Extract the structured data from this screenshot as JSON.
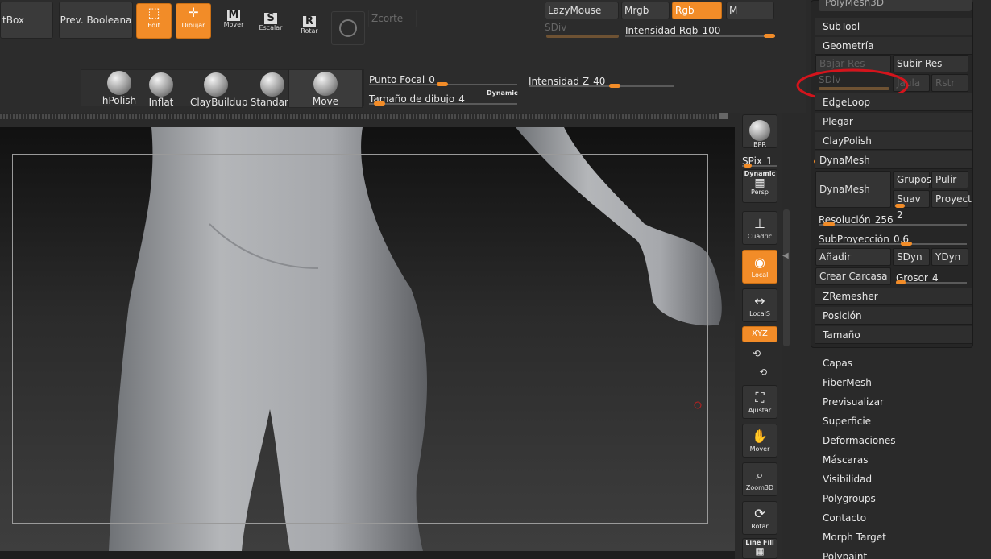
{
  "toolbar": {
    "lightbox_label": "tBox",
    "prev_booleana_label": "Prev. Booleana",
    "edit_label": "Edit",
    "dibujar_label": "Dibujar",
    "mover_label": "Mover",
    "escalar_label": "Escalar",
    "rotar_label": "Rotar",
    "zcorte_label": "Zcorte",
    "lazymouse_label": "LazyMouse",
    "mrgb_label": "Mrgb",
    "rgb_label": "Rgb",
    "m_label": "M",
    "sdiv_label": "SDiv",
    "intensidad_rgb_label": "Intensidad Rgb",
    "intensidad_rgb_value": "100",
    "punto_focal_label": "Punto Focal",
    "punto_focal_value": "0",
    "tamano_dibujo_label": "Tamaño de dibujo",
    "tamano_dibujo_value": "4",
    "dynamic_label": "Dynamic",
    "intensidad_z_label": "Intensidad Z",
    "intensidad_z_value": "40"
  },
  "brushes": [
    {
      "label": "hPolish"
    },
    {
      "label": "Inflat"
    },
    {
      "label": "ClayBuildup"
    },
    {
      "label": "Standard"
    },
    {
      "label": "Move"
    }
  ],
  "right_tools": {
    "bpr": "BPR",
    "spix_label": "SPix",
    "spix_value": "1",
    "dynamic": "Dynamic",
    "persp": "Persp",
    "cuadric": "Cuadric",
    "local": "Local",
    "locals": "LocalS",
    "xyz": "XYZ",
    "ajustar": "Ajustar",
    "mover": "Mover",
    "zoom3d": "Zoom3D",
    "rotar": "Rotar",
    "line_fill": "Line Fill"
  },
  "panel": {
    "polymesh_label": "PolyMesh3D",
    "subtool": "SubTool",
    "geometria": "Geometría",
    "bajar_res": "Bajar Res",
    "subir_res": "Subir Res",
    "sdiv": "SDiv",
    "jaula": "Jaula",
    "rstr": "Rstr",
    "edgeloop": "EdgeLoop",
    "plegar": "Plegar",
    "claypolish": "ClayPolish",
    "dynamesh_header": "DynaMesh",
    "dynamesh_btn": "DynaMesh",
    "grupos": "Grupos",
    "pulir": "Pulir",
    "suav": "Suav",
    "suav_value": "2",
    "proyect": "Proyect",
    "resolucion_label": "Resolución",
    "resolucion_value": "256",
    "subproyeccion_label": "SubProyección",
    "subproyeccion_value": "0.6",
    "anadir": "Añadir",
    "sdyn": "SDyn",
    "ydyn": "YDyn",
    "crear_carcasa": "Crear Carcasa",
    "grosor_label": "Grosor",
    "grosor_value": "4",
    "zremesher": "ZRemesher",
    "posicion": "Posición",
    "tamano": "Tamaño"
  },
  "menu": {
    "items": [
      "Capas",
      "FiberMesh",
      "Previsualizar",
      "Superficie",
      "Deformaciones",
      "Máscaras",
      "Visibilidad",
      "Polygroups",
      "Contacto",
      "Morph Target",
      "Polypaint"
    ]
  },
  "colors": {
    "accent": "#f28c28",
    "annotation_ellipse": "#d4141c"
  }
}
